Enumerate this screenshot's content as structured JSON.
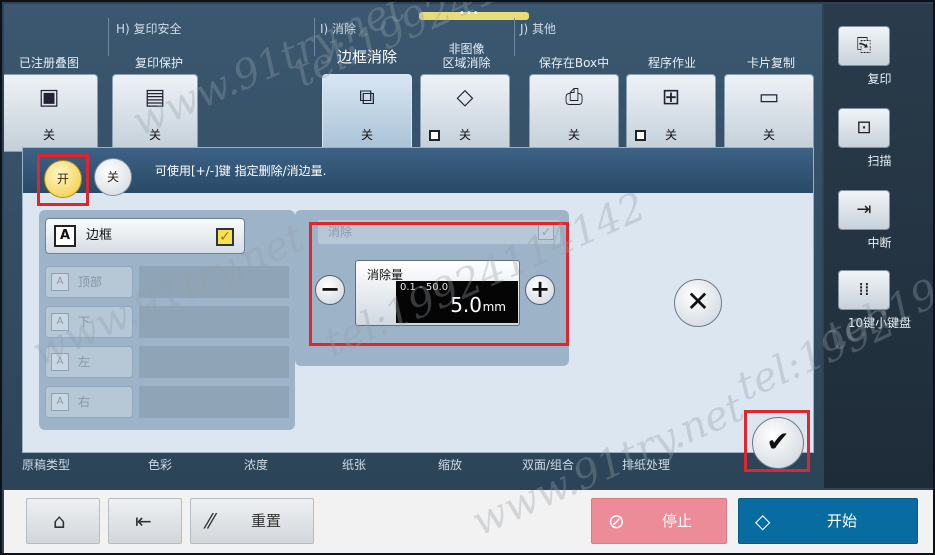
{
  "top_groups": [
    {
      "label": "H)  复印安全"
    },
    {
      "label": "I)  消除"
    },
    {
      "label": "J)  其他"
    }
  ],
  "functions": [
    {
      "label": "已注册叠图",
      "state": "关",
      "icon": "overlay-icon"
    },
    {
      "label": "复印保护",
      "state": "关",
      "icon": "copy-protect-icon"
    },
    {
      "label": "边框消除",
      "state": "关",
      "icon": "frame-erase-icon",
      "active": true
    },
    {
      "label": "非图像\n区域消除",
      "state": "关",
      "icon": "non-image-erase-icon",
      "checkbox": true
    },
    {
      "label": "保存在Box中",
      "state": "关",
      "icon": "save-box-icon"
    },
    {
      "label": "程序作业",
      "state": "关",
      "icon": "program-job-icon",
      "checkbox": true
    },
    {
      "label": "卡片复制",
      "state": "关",
      "icon": "card-copy-icon"
    }
  ],
  "dialog": {
    "on_label": "开",
    "off_label": "关",
    "message": "可使用[+/-]键 指定删除/消边量.",
    "frame_label": "边框",
    "sides": [
      {
        "label": "顶部",
        "icon_text": "A"
      },
      {
        "label": "下",
        "icon_text": "A"
      },
      {
        "label": "左",
        "icon_text": "A"
      },
      {
        "label": "右",
        "icon_text": "A"
      }
    ],
    "erase_label": "消除",
    "amount_title": "消除量",
    "amount_range": "0.1 - 50.0",
    "amount_value": "5.0",
    "amount_unit": "mm",
    "minus": "−",
    "plus": "+",
    "cancel": "✕",
    "ok": "✔"
  },
  "bottom_tabs": [
    "原稿类型",
    "色彩",
    "浓度",
    "纸张",
    "缩放",
    "双面/组合",
    "排纸处理"
  ],
  "right_panel": [
    {
      "label": "复印",
      "icon": "copy-icon"
    },
    {
      "label": "扫描",
      "icon": "scan-icon"
    },
    {
      "label": "中断",
      "icon": "interrupt-icon"
    },
    {
      "label": "10键小键盘",
      "icon": "keypad-icon"
    }
  ],
  "bottom_bar": {
    "reset_label": "重置",
    "stop_label": "停止",
    "start_label": "开始"
  },
  "watermarks": [
    "tel:19924114142",
    "www.91try.net",
    "tel:19924114142",
    "www.91try.net",
    "tel:1992",
    "www.91try.net",
    "tel:1992"
  ]
}
